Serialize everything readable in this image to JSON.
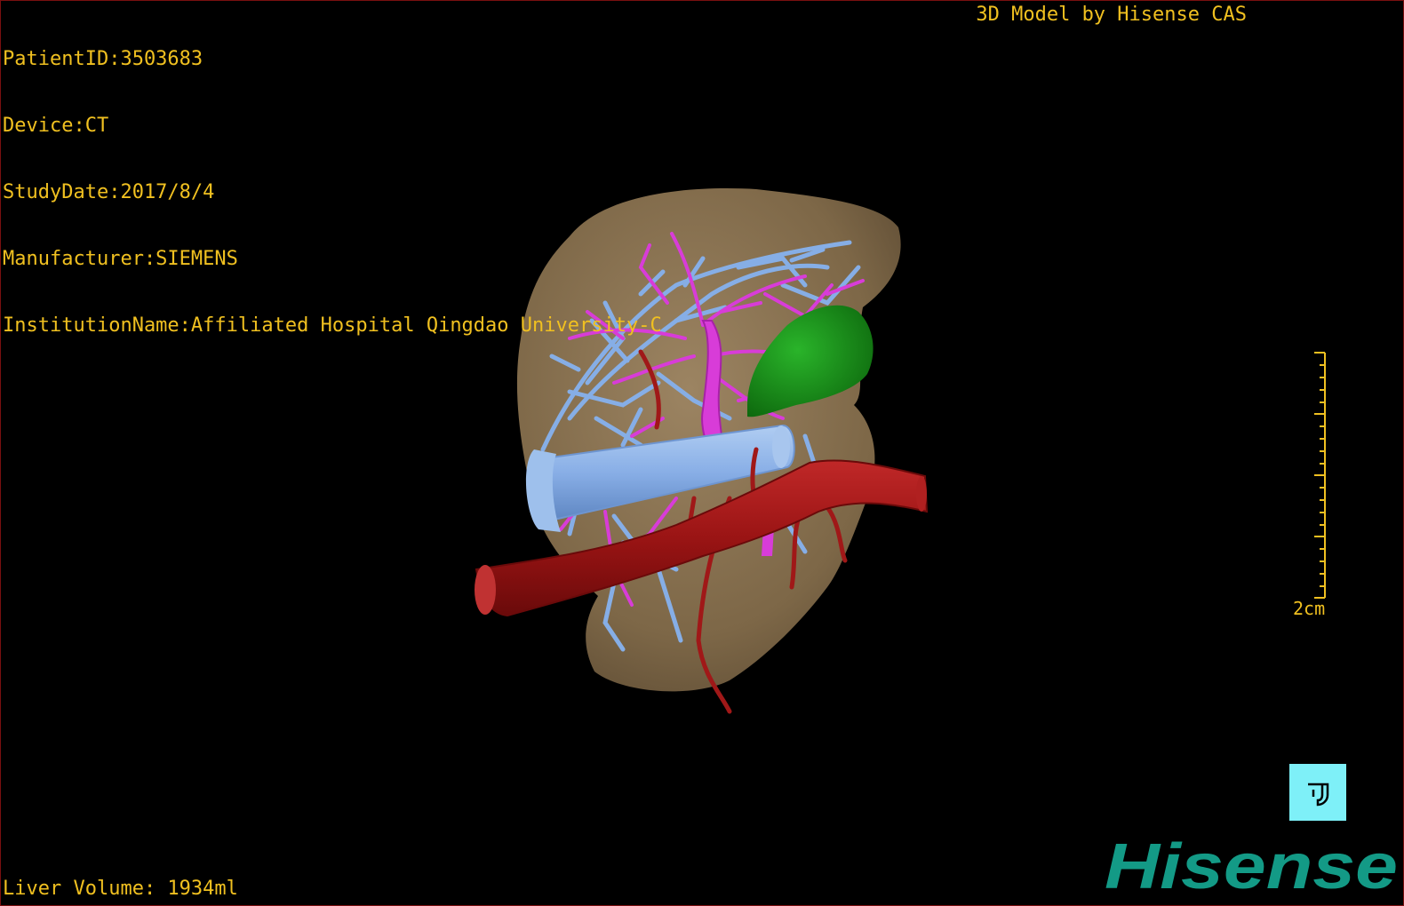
{
  "header": {
    "patient_id": "PatientID:3503683",
    "device": "Device:CT",
    "study_date": "StudyDate:2017/8/4",
    "manufacturer": "Manufacturer:SIEMENS",
    "institution": "InstitutionName:Affiliated Hospital Qingdao University-C"
  },
  "credit": "3D Model by Hisense CAS",
  "footer": {
    "liver_volume": "Liver Volume: 1934ml"
  },
  "scale_bar": {
    "label": "2cm"
  },
  "orientation_button": {
    "icon": "orientation-cube-icon"
  },
  "logo": {
    "text": "Hisense"
  },
  "colors": {
    "overlay_text": "#f0c020",
    "liver": "#8f7755",
    "hepatic_vein": "#86aee6",
    "portal_vein": "#d83cd8",
    "artery": "#a01818",
    "gallbladder": "#1c9a1c",
    "logo": "#139a86",
    "orient_bg": "#7ef0f8"
  }
}
